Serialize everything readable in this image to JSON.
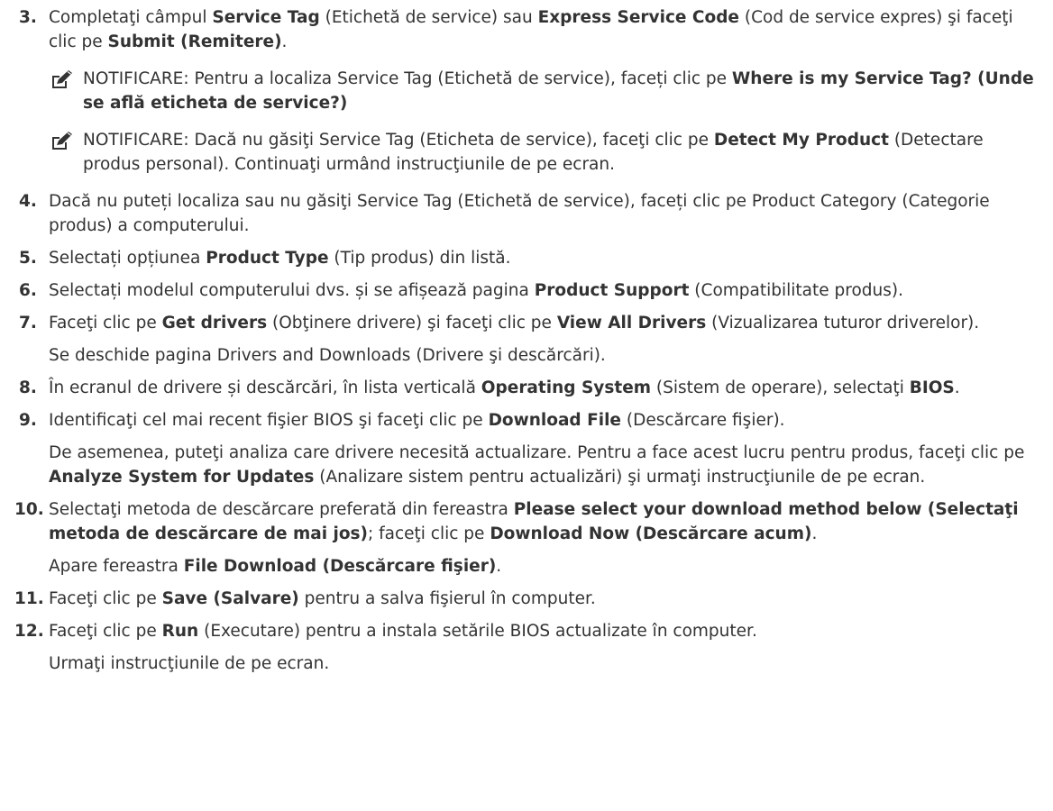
{
  "steps": [
    {
      "number": "3.",
      "segments": [
        {
          "t": "Completaţi câmpul "
        },
        {
          "t": "Service Tag",
          "b": true
        },
        {
          "t": " (Etichetă de service) sau "
        },
        {
          "t": "Express Service Code",
          "b": true
        },
        {
          "t": " (Cod de service expres) şi faceţi clic pe "
        },
        {
          "t": "Submit (Remitere)",
          "b": true
        },
        {
          "t": "."
        }
      ],
      "notes": [
        {
          "icon": "pencil-note-icon",
          "label": "NOTIFICARE:",
          "segments": [
            {
              "t": " Pentru a localiza Service Tag (Etichetă de service), faceți clic pe "
            },
            {
              "t": "Where is my Service Tag? (Unde se află eticheta de service?)",
              "b": true
            }
          ]
        },
        {
          "icon": "pencil-note-icon",
          "label": "NOTIFICARE:",
          "segments": [
            {
              "t": " Dacă nu găsiţi Service Tag (Eticheta de service), faceţi clic pe "
            },
            {
              "t": "Detect My Product",
              "b": true
            },
            {
              "t": " (Detectare produs personal). Continuaţi urmând instrucţiunile de pe ecran."
            }
          ]
        }
      ]
    },
    {
      "number": "4.",
      "segments": [
        {
          "t": "Dacă nu puteți localiza sau nu găsiţi Service Tag (Etichetă de service), faceți clic pe Product Category (Categorie produs) a computerului."
        }
      ]
    },
    {
      "number": "5.",
      "segments": [
        {
          "t": "Selectați opțiunea "
        },
        {
          "t": "Product Type",
          "b": true
        },
        {
          "t": " (Tip produs) din listă."
        }
      ]
    },
    {
      "number": "6.",
      "segments": [
        {
          "t": "Selectați modelul computerului dvs. și se afișează pagina "
        },
        {
          "t": "Product Support",
          "b": true
        },
        {
          "t": " (Compatibilitate produs)."
        }
      ]
    },
    {
      "number": "7.",
      "segments": [
        {
          "t": "Faceţi clic pe "
        },
        {
          "t": "Get drivers",
          "b": true
        },
        {
          "t": " (Obţinere drivere) şi faceţi clic pe "
        },
        {
          "t": "View All Drivers",
          "b": true
        },
        {
          "t": " (Vizualizarea tuturor driverelor)."
        }
      ],
      "sub": [
        [
          {
            "t": "Se deschide pagina Drivers and Downloads (Drivere şi descărcări)."
          }
        ]
      ]
    },
    {
      "number": "8.",
      "segments": [
        {
          "t": "În ecranul de drivere și descărcări, în lista verticală "
        },
        {
          "t": "Operating System",
          "b": true
        },
        {
          "t": " (Sistem de operare), selectaţi "
        },
        {
          "t": "BIOS",
          "b": true
        },
        {
          "t": "."
        }
      ]
    },
    {
      "number": "9.",
      "segments": [
        {
          "t": "Identificaţi cel mai recent fişier BIOS şi faceţi clic pe "
        },
        {
          "t": "Download File",
          "b": true
        },
        {
          "t": " (Descărcare fişier)."
        }
      ],
      "sub": [
        [
          {
            "t": "De asemenea, puteţi analiza care drivere necesită actualizare. Pentru a face acest lucru pentru produs, faceţi clic pe "
          },
          {
            "t": "Analyze System for Updates",
            "b": true
          },
          {
            "t": " (Analizare sistem pentru actualizări) şi urmaţi instrucţiunile de pe ecran."
          }
        ]
      ]
    },
    {
      "number": "10.",
      "segments": [
        {
          "t": "Selectaţi metoda de descărcare preferată din fereastra "
        },
        {
          "t": "Please select your download method below (Selectaţi metoda de descărcare de mai jos)",
          "b": true
        },
        {
          "t": "; faceţi clic pe "
        },
        {
          "t": "Download Now (Descărcare acum)",
          "b": true
        },
        {
          "t": "."
        }
      ],
      "sub": [
        [
          {
            "t": "Apare fereastra "
          },
          {
            "t": "File Download (Descărcare fişier)",
            "b": true
          },
          {
            "t": "."
          }
        ]
      ]
    },
    {
      "number": "11.",
      "segments": [
        {
          "t": "Faceţi clic pe "
        },
        {
          "t": "Save (Salvare)",
          "b": true
        },
        {
          "t": " pentru a salva fişierul în computer."
        }
      ]
    },
    {
      "number": "12.",
      "segments": [
        {
          "t": "Faceţi clic pe "
        },
        {
          "t": "Run",
          "b": true
        },
        {
          "t": " (Executare) pentru a instala setările BIOS actualizate în computer."
        }
      ],
      "sub": [
        [
          {
            "t": "Urmaţi instrucţiunile de pe ecran."
          }
        ]
      ]
    }
  ]
}
